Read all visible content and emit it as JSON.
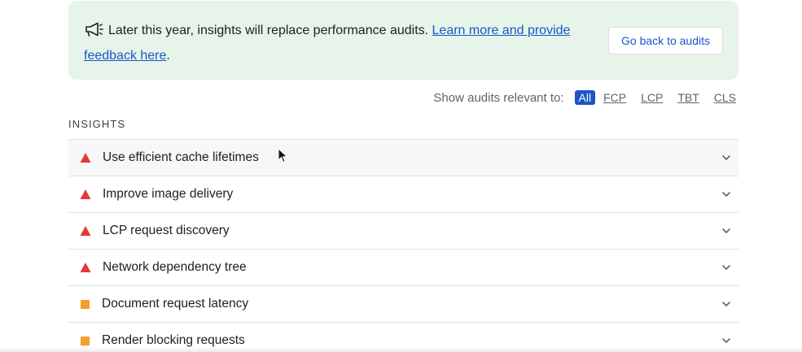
{
  "banner": {
    "text": "Later this year, insights will replace performance audits.",
    "link_text": "Learn more and provide feedback here",
    "trailing": ".",
    "icon": "megaphone-icon",
    "back_button_label": "Go back to audits",
    "background_color": "#e6f4ea"
  },
  "filter": {
    "label": "Show audits relevant to:",
    "options": [
      "All",
      "FCP",
      "LCP",
      "TBT",
      "CLS"
    ],
    "selected": "All",
    "accent_color": "#1a56c7"
  },
  "section": {
    "title": "INSIGHTS"
  },
  "audits": [
    {
      "title": "Use efficient cache lifetimes",
      "status": "fail",
      "icon": "red-triangle-icon"
    },
    {
      "title": "Improve image delivery",
      "status": "fail",
      "icon": "red-triangle-icon"
    },
    {
      "title": "LCP request discovery",
      "status": "fail",
      "icon": "red-triangle-icon"
    },
    {
      "title": "Network dependency tree",
      "status": "fail",
      "icon": "red-triangle-icon"
    },
    {
      "title": "Document request latency",
      "status": "average",
      "icon": "orange-square-icon"
    },
    {
      "title": "Render blocking requests",
      "status": "average",
      "icon": "orange-square-icon"
    }
  ],
  "colors": {
    "fail": "#e53935",
    "average": "#f29f2f"
  }
}
